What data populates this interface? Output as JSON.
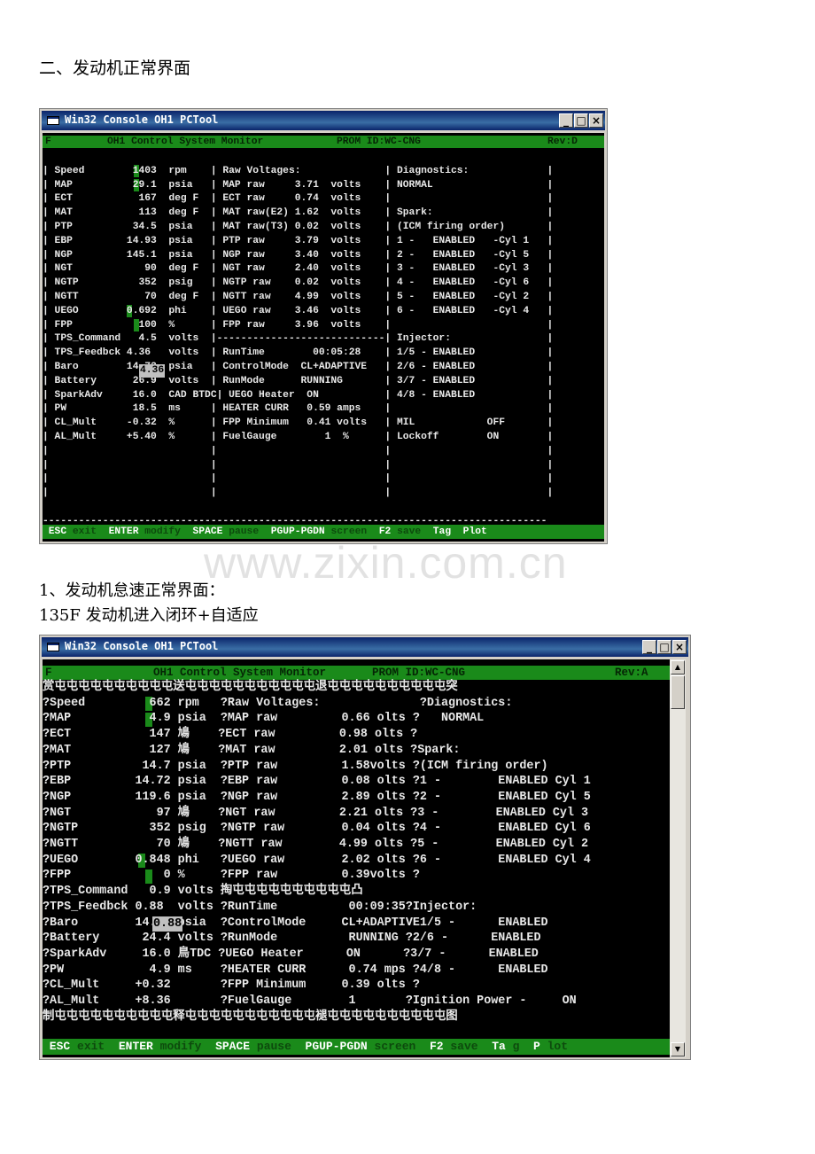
{
  "heading_top": "二、发动机正常界面",
  "heading_mid": "1、发动机怠速正常界面：",
  "heading_sub": "135F 发动机进入闭环+自适应",
  "watermark": "www.zixin.com.cn",
  "window1": {
    "title": "Win32 Console OH1 PCTool",
    "header": {
      "f": "F",
      "system": "OH1 Control System Monitor",
      "prom": "PROM ID:WC-CNG",
      "rev": "Rev:D"
    },
    "lines": [
      "",
      "| Speed        1403  rpm    | Raw Voltages:              | Diagnostics:             |",
      "| MAP          29.1  psia   | MAP raw     3.71  volts    | NORMAL                   |",
      "| ECT           167  deg F  | ECT raw     0.74  volts    |                          |",
      "| MAT           113  deg F  | MAT raw(E2) 1.62  volts    | Spark:                   |",
      "| PTP          34.5  psia   | MAT raw(T3) 0.02  volts    | (ICM firing order)       |",
      "| EBP         14.93  psia   | PTP raw     3.79  volts    | 1 -   ENABLED   -Cyl 1   |",
      "| NGP         145.1  psia   | NGP raw     3.40  volts    | 2 -   ENABLED   -Cyl 5   |",
      "| NGT            90  deg F  | NGT raw     2.40  volts    | 3 -   ENABLED   -Cyl 3   |",
      "| NGTP          352  psig   | NGTP raw    0.02  volts    | 4 -   ENABLED   -Cyl 6   |",
      "| NGTT           70  deg F  | NGTT raw    4.99  volts    | 5 -   ENABLED   -Cyl 2   |",
      "| UEGO        0.692  phi    | UEGO raw    3.46  volts    | 6 -   ENABLED   -Cyl 4   |",
      "| FPP           100  %      | FPP raw     3.96  volts    |                          |",
      "| TPS_Command   4.5  volts  |----------------------------| Injector:                |",
      "| TPS_Feedbck 4.36   volts  | RunTime        00:05:28    | 1/5 - ENABLED            |",
      "| Baro        14.72  psia   | ControlMode  CL+ADAPTIVE   | 2/6 - ENABLED            |",
      "| Battery      26.9  volts  | RunMode      RUNNING       | 3/7 - ENABLED            |",
      "| SparkAdv     16.0  CAD BTDC| UEGO Heater  ON           | 4/8 - ENABLED            |",
      "| PW           18.5  ms     | HEATER CURR   0.59 amps    |                          |",
      "| CL_Mult     -0.32  %      | FPP Minimum   0.41 volts   | MIL            OFF       |",
      "| AL_Mult     +5.40  %      | FuelGauge        1  %      | Lockoff        ON        |",
      "|                           |                            |                          |",
      "|                           |                            |                          |",
      "|                           |                            |                          |",
      "|                           |                            |                          |",
      "",
      "------------------------------------------------------------------------------------"
    ],
    "footer": [
      {
        "key": "ESC",
        "desc": "exit"
      },
      {
        "key": "ENTER",
        "desc": "modify"
      },
      {
        "key": "SPACE",
        "desc": "pause"
      },
      {
        "key": "PGUP-PGDN",
        "desc": "screen"
      },
      {
        "key": "F2",
        "desc": "save"
      },
      {
        "key": "Tag",
        "desc": ""
      },
      {
        "key": "Plot",
        "desc": ""
      }
    ]
  },
  "window2": {
    "title": "Win32 Console OH1 PCTool",
    "header": {
      "f": "F",
      "system": "OH1 Control System Monitor",
      "prom": "PROM ID:WC-CNG",
      "rev": "Rev:A"
    },
    "lines": [
      "赏屯屯屯屯屯屯屯屯屯屯送屯屯屯屯屯屯屯屯屯屯屯退屯屯屯屯屯屯屯屯屯屯突",
      "?Speed         662 rpm   ?Raw Voltages:              ?Diagnostics:",
      "?MAP           4.9 psia  ?MAP raw         0.66 olts ?   NORMAL",
      "?ECT           147 鳩    ?ECT raw         0.98 olts ?",
      "?MAT           127 鳩    ?MAT raw         2.01 olts ?Spark:",
      "?PTP          14.7 psia  ?PTP raw         1.58volts ?(ICM firing order)",
      "?EBP         14.72 psia  ?EBP raw         0.08 olts ?1 -        ENABLED Cyl 1",
      "?NGP         119.6 psia  ?NGP raw         2.89 olts ?2 -        ENABLED Cyl 5",
      "?NGT            97 鳩    ?NGT raw         2.21 olts ?3 -        ENABLED Cyl 3",
      "?NGTP          352 psig  ?NGTP raw        0.04 olts ?4 -        ENABLED Cyl 6",
      "?NGTT           70 鳩    ?NGTT raw        4.99 olts ?5 -        ENABLED Cyl 2",
      "?UEGO        0.848 phi   ?UEGO raw        2.02 olts ?6 -        ENABLED Cyl 4",
      "?FPP             0 %     ?FPP raw         0.39volts ?",
      "?TPS_Command   0.9 volts 掏屯屯屯屯屯屯屯屯屯屯凸",
      "?TPS_Feedbck 0.88  volts ?RunTime          00:09:35?Injector:",
      "?Baro        14.72 psia  ?ControlMode     CL+ADAPTIVE1/5 -      ENABLED",
      "?Battery      24.4 volts ?RunMode          RUNNING ?2/6 -      ENABLED",
      "?SparkAdv     16.0 鳥TDC ?UEGO Heater      ON      ?3/7 -      ENABLED",
      "?PW            4.9 ms    ?HEATER CURR      0.74 mps ?4/8 -      ENABLED",
      "?CL_Mult     +0.32       ?FPP Minimum     0.39 olts ?",
      "?AL_Mult     +8.36       ?FuelGauge        1       ?Ignition Power -     ON",
      "制屯屯屯屯屯屯屯屯屯屯释屯屯屯屯屯屯屯屯屯屯屯褪屯屯屯屯屯屯屯屯屯屯图"
    ],
    "footer": [
      {
        "key": "ESC",
        "desc": "exit"
      },
      {
        "key": "ENTER",
        "desc": "modify"
      },
      {
        "key": "SPACE",
        "desc": "pause"
      },
      {
        "key": "PGUP-PGDN",
        "desc": "screen"
      },
      {
        "key": "F2",
        "desc": "save"
      },
      {
        "key": "Ta",
        "desc": "g"
      },
      {
        "key": "P",
        "desc": "lot"
      }
    ]
  },
  "title_buttons": {
    "minimize": "_",
    "maximize": "□",
    "close": "×"
  },
  "scroll_arrows": {
    "up": "▲",
    "down": "▼"
  },
  "colors": {
    "terminal_bg": "#000000",
    "status_green": "#1a8a1a",
    "titlebar": "#0a246a",
    "window_frame": "#d4d0c8"
  }
}
